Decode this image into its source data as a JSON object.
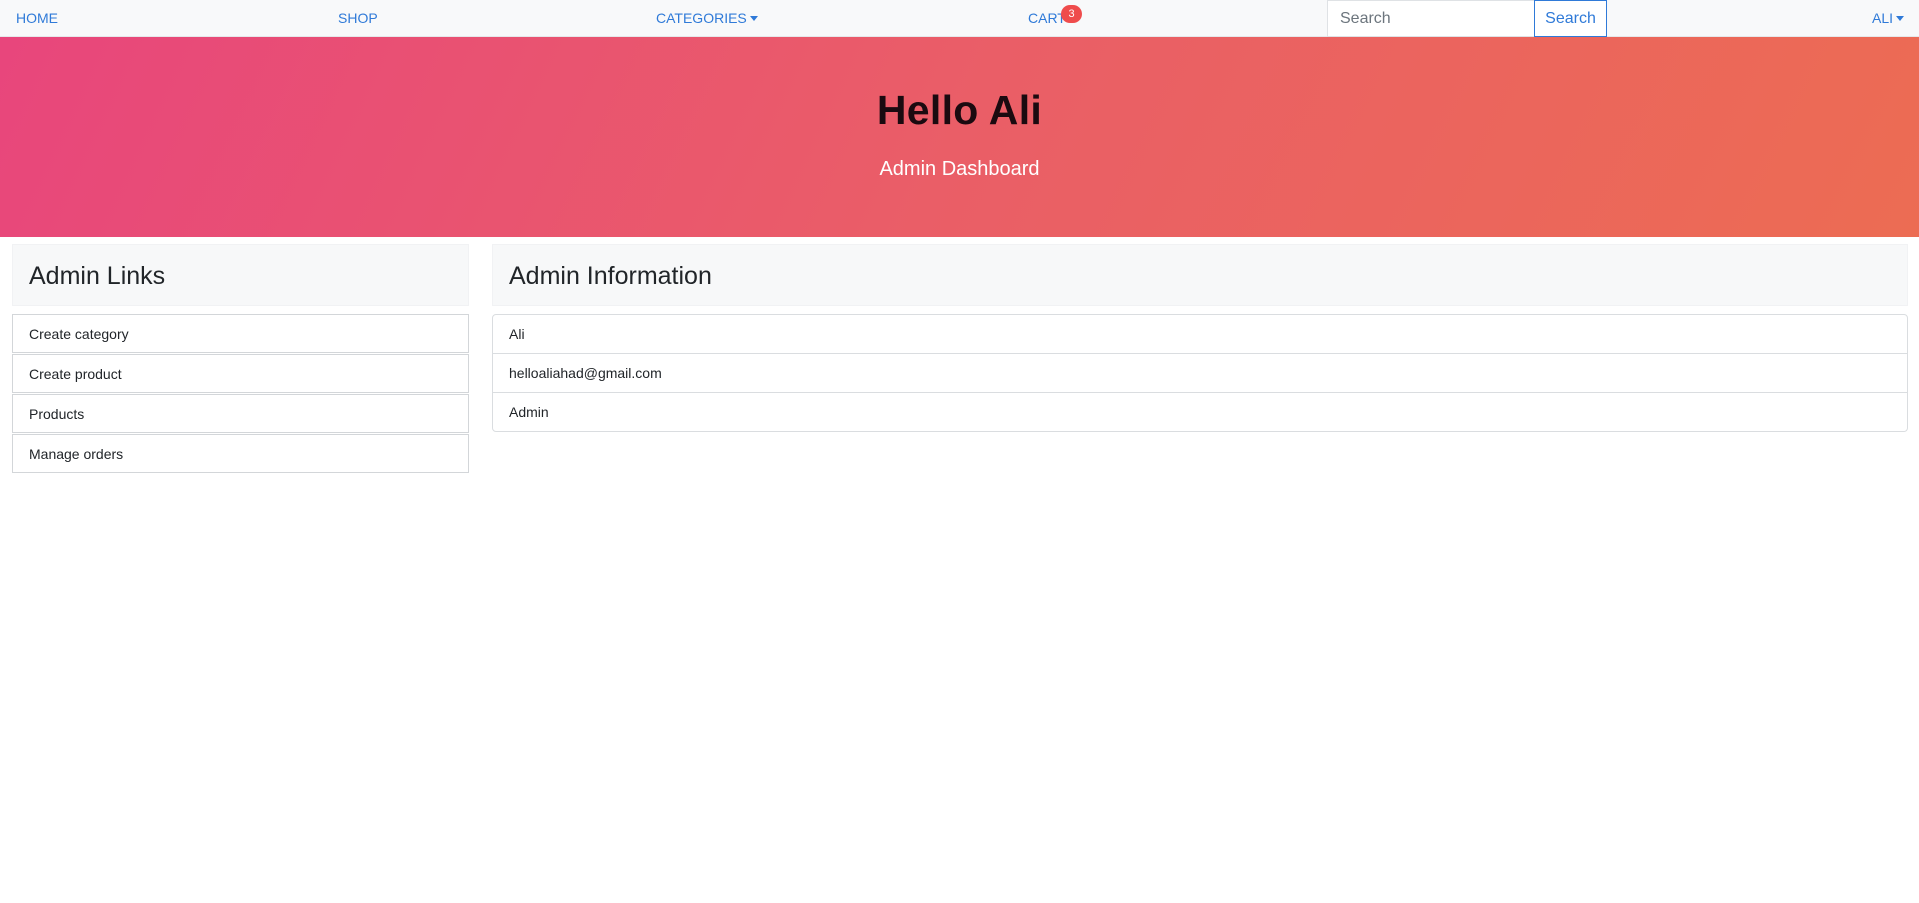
{
  "navbar": {
    "home": "HOME",
    "shop": "SHOP",
    "categories": "CATEGORIES",
    "cart": "CART",
    "cart_count": "3",
    "search_placeholder": "Search",
    "search_button": "Search",
    "user": "ALI"
  },
  "hero": {
    "title": "Hello Ali",
    "subtitle": "Admin Dashboard"
  },
  "admin_links": {
    "title": "Admin Links",
    "items": [
      {
        "label": "Create category"
      },
      {
        "label": "Create product"
      },
      {
        "label": "Products"
      },
      {
        "label": "Manage orders"
      }
    ]
  },
  "admin_info": {
    "title": "Admin Information",
    "name": "Ali",
    "email": "helloaliahad@gmail.com",
    "role": "Admin"
  },
  "colors": {
    "link": "#2f7ad8",
    "badge": "#ef4c4c",
    "hero_gradient_start": "#e8467c",
    "hero_gradient_end": "#ec6c53"
  }
}
